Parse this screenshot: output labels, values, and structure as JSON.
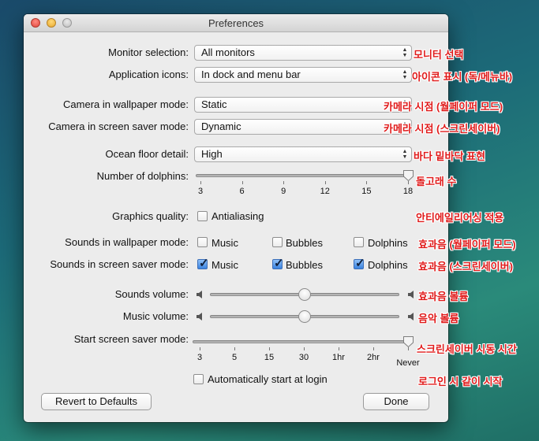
{
  "window": {
    "title": "Preferences"
  },
  "monitor": {
    "label": "Monitor selection:",
    "value": "All monitors",
    "annotation": "모니터 선택"
  },
  "app_icons": {
    "label": "Application icons:",
    "value": "In dock and menu bar",
    "annotation": "아이콘 표시 (독/메뉴바)"
  },
  "camera_wallpaper": {
    "label": "Camera in wallpaper mode:",
    "value": "Static",
    "annotation": "카메라 시점 (월페이퍼 모드)"
  },
  "camera_screensaver": {
    "label": "Camera in screen saver mode:",
    "value": "Dynamic",
    "annotation": "카메라 시점 (스크린세이버)"
  },
  "ocean_floor": {
    "label": "Ocean floor detail:",
    "value": "High",
    "annotation": "바다 밑바닥 표현"
  },
  "dolphins": {
    "label": "Number of dolphins:",
    "ticks": [
      "3",
      "6",
      "9",
      "12",
      "15",
      "18"
    ],
    "value": 18,
    "annotation": "돌고래 수"
  },
  "graphics": {
    "label": "Graphics quality:",
    "checkbox_label": "Antialiasing",
    "checked": false,
    "annotation": "안티에일리어싱 적용"
  },
  "sounds_wallpaper": {
    "label": "Sounds in wallpaper mode:",
    "options": [
      {
        "label": "Music",
        "checked": false
      },
      {
        "label": "Bubbles",
        "checked": false
      },
      {
        "label": "Dolphins",
        "checked": false
      }
    ],
    "annotation": "효과음 (월페이퍼 모드)"
  },
  "sounds_screensaver": {
    "label": "Sounds in screen saver mode:",
    "options": [
      {
        "label": "Music",
        "checked": true
      },
      {
        "label": "Bubbles",
        "checked": true
      },
      {
        "label": "Dolphins",
        "checked": true
      }
    ],
    "annotation": "효과음 (스크린세이버)"
  },
  "sounds_volume": {
    "label": "Sounds volume:",
    "value": 0.5,
    "annotation": "효과음 볼륨"
  },
  "music_volume": {
    "label": "Music volume:",
    "value": 0.5,
    "annotation": "음악 볼륨"
  },
  "start_mode": {
    "label": "Start screen saver mode:",
    "ticks": [
      "3",
      "5",
      "15",
      "30",
      "1hr",
      "2hr",
      "Never"
    ],
    "value": "Never",
    "annotation": "스크린세이버 시동 시간"
  },
  "auto_start": {
    "checkbox_label": "Automatically start at login",
    "checked": false,
    "annotation": "로그인 시 같이 시작"
  },
  "buttons": {
    "revert": "Revert to Defaults",
    "done": "Done"
  }
}
